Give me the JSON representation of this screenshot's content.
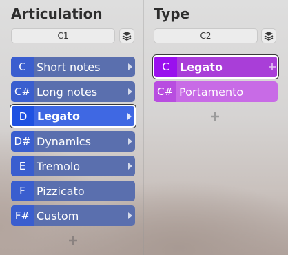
{
  "articulation": {
    "title": "Articulation",
    "selector": "C1",
    "items": [
      {
        "key": "C",
        "label": "Short notes"
      },
      {
        "key": "C#",
        "label": "Long notes"
      },
      {
        "key": "D",
        "label": "Legato"
      },
      {
        "key": "D#",
        "label": "Dynamics"
      },
      {
        "key": "E",
        "label": "Tremolo"
      },
      {
        "key": "F",
        "label": "Pizzicato"
      },
      {
        "key": "F#",
        "label": "Custom"
      }
    ],
    "selected_index": 2
  },
  "type": {
    "title": "Type",
    "selector": "C2",
    "items": [
      {
        "key": "C",
        "label": "Legato"
      },
      {
        "key": "C#",
        "label": "Portamento"
      }
    ],
    "selected_index": 0
  },
  "colors": {
    "articulation_slot": "#5a6fae",
    "articulation_key": "#3a5ecf",
    "articulation_selected": "#3f68e3",
    "type_slot": "#c86be6",
    "type_selected": "#a93ed8"
  },
  "icons": {
    "layers": "layers-icon",
    "chevron": "chevron-right-icon",
    "add": "plus-icon"
  }
}
